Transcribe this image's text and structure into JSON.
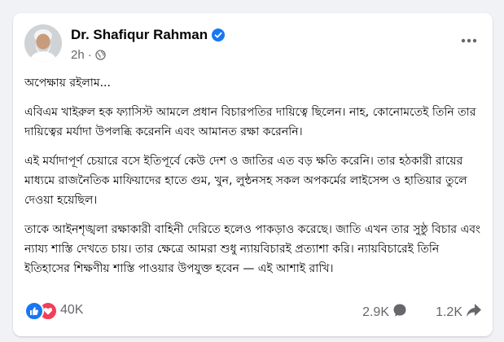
{
  "post": {
    "author": "Dr. Shafiqur Rahman",
    "time": "2h",
    "separator": "·",
    "paragraphs": [
      "অপেক্ষায় রইলাম...",
      "এবিএম খাইরুল হক ফ্যাসিস্ট আমলে প্রধান বিচারপতির দায়িত্বে ছিলেন। নাহ, কোনোমতেই তিনি তার দায়িত্বের মর্যাদা উপলব্ধি করেননি এবং আমানত রক্ষা করেননি।",
      "এই মর্যাদাপূর্ণ চেয়ারে বসে ইতিপূর্বে কেউ দেশ ও জাতির এত বড় ক্ষতি করেনি। তার হঠকারী রায়ের মাধ্যমে রাজনৈতিক মাফিয়াদের হাতে গুম, খুন, লুন্ঠনসহ সকল অপকর্মের লাইসেন্স ও হাতিয়ার তুলে দেওয়া হয়েছিল।",
      "তাকে আইনশৃঙ্খলা রক্ষাকারী বাহিনী দেরিতে হলেও পাকড়াও করেছে। জাতি এখন তার সুষ্ঠু বিচার এবং ন্যায্য শাস্তি দেখতে চায়। তার ক্ষেত্রে আমরা শুধু ন্যায়বিচারই প্রত্যাশা করি। ন্যায়বিচারেই তিনি ইতিহাসের শিক্ষণীয় শাস্তি পাওয়ার উপযুক্ত হবেন — এই আশাই রাখি।"
    ]
  },
  "footer": {
    "reactions": "40K",
    "comments": "2.9K",
    "shares": "1.2K"
  },
  "colors": {
    "accent": "#1877f2",
    "love": "#f33e58",
    "muted": "#65676b",
    "text": "#050505"
  },
  "icons": [
    "verified-badge-icon",
    "globe-icon",
    "more-options-icon",
    "like-reaction-icon",
    "love-reaction-icon",
    "comment-icon",
    "share-icon"
  ]
}
